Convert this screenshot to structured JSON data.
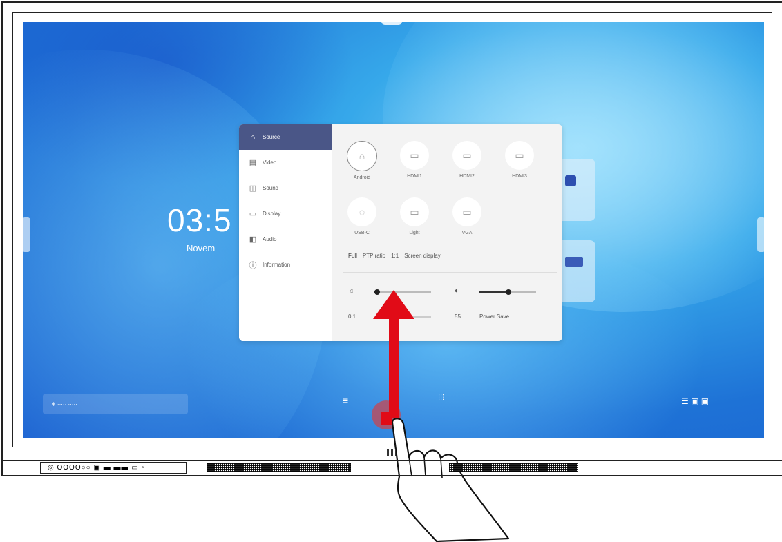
{
  "screen": {
    "clock": "03:5",
    "date": "Novem",
    "quick_bar_text": "❄ ·····  ·····",
    "right_dock_icons": "☰ ▣ ▣"
  },
  "settings_panel": {
    "menu": [
      {
        "label": "Source",
        "icon": "home-icon"
      },
      {
        "label": "Video",
        "icon": "picture-icon"
      },
      {
        "label": "Sound",
        "icon": "sound-icon"
      },
      {
        "label": "Display",
        "icon": "display-icon"
      },
      {
        "label": "Audio",
        "icon": "audio-icon"
      },
      {
        "label": "Information",
        "icon": "info-icon"
      }
    ],
    "sources": [
      {
        "label": "Android"
      },
      {
        "label": "HDMI1"
      },
      {
        "label": "HDMI2"
      },
      {
        "label": "HDMI3"
      },
      {
        "label": "USB-C"
      },
      {
        "label": "Light"
      },
      {
        "label": "VGA"
      }
    ],
    "ratio_options": [
      "Full",
      "PTP ratio",
      "1:1",
      "Screen display"
    ],
    "slider_labels": {
      "left_value": "0.1",
      "right_value": "55",
      "right_text": "Power Save"
    }
  },
  "front_panel": {
    "ports_text": "◎ OOOO○○  ▣ ▬ ▬▬ ▭ ▫"
  }
}
